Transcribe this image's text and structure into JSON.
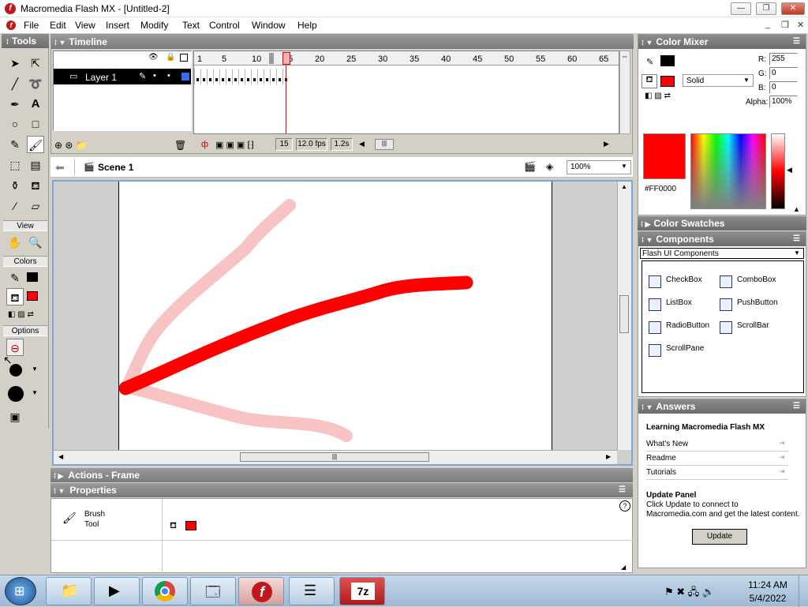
{
  "window": {
    "title": "Macromedia Flash MX - [Untitled-2]",
    "min": "—",
    "max": "❐",
    "close": "✕"
  },
  "menu": [
    "File",
    "Edit",
    "View",
    "Insert",
    "Modify",
    "Text",
    "Control",
    "Window",
    "Help"
  ],
  "tools": {
    "header": "Tools",
    "view_label": "View",
    "colors_label": "Colors",
    "options_label": "Options",
    "stroke_color": "#000000",
    "fill_color": "#ff0000"
  },
  "timeline": {
    "header": "Timeline",
    "layer_name": "Layer 1",
    "ruler": [
      "1",
      "5",
      "10",
      "15",
      "20",
      "25",
      "30",
      "35",
      "40",
      "45",
      "50",
      "55",
      "60",
      "65"
    ],
    "current_frame": "15",
    "fps": "12.0 fps",
    "time": "1.2s"
  },
  "scene": {
    "name": "Scene 1",
    "zoom": "100%"
  },
  "panels": {
    "actions": "Actions - Frame",
    "properties": "Properties",
    "tool_name_1": "Brush",
    "tool_name_2": "Tool",
    "help": "?"
  },
  "color_mixer": {
    "header": "Color Mixer",
    "fill_type": "Solid",
    "r_label": "R:",
    "r": "255",
    "g_label": "G:",
    "g": "0",
    "b_label": "B:",
    "b": "0",
    "alpha_label": "Alpha:",
    "alpha": "100%",
    "hex": "#FF0000",
    "color": "#ff0000"
  },
  "color_swatches": {
    "header": "Color Swatches"
  },
  "components": {
    "header": "Components",
    "set": "Flash UI Components",
    "items": [
      "CheckBox",
      "ComboBox",
      "ListBox",
      "PushButton",
      "RadioButton",
      "ScrollBar",
      "ScrollPane"
    ]
  },
  "answers": {
    "header": "Answers",
    "title": "Learning Macromedia Flash MX",
    "links": [
      "What's New",
      "Readme",
      "Tutorials"
    ],
    "update_title": "Update Panel",
    "update_text": "Click Update to connect to Macromedia.com and get the latest content.",
    "update_button": "Update"
  },
  "taskbar": {
    "time": "11:24 AM",
    "date": "5/4/2022"
  }
}
